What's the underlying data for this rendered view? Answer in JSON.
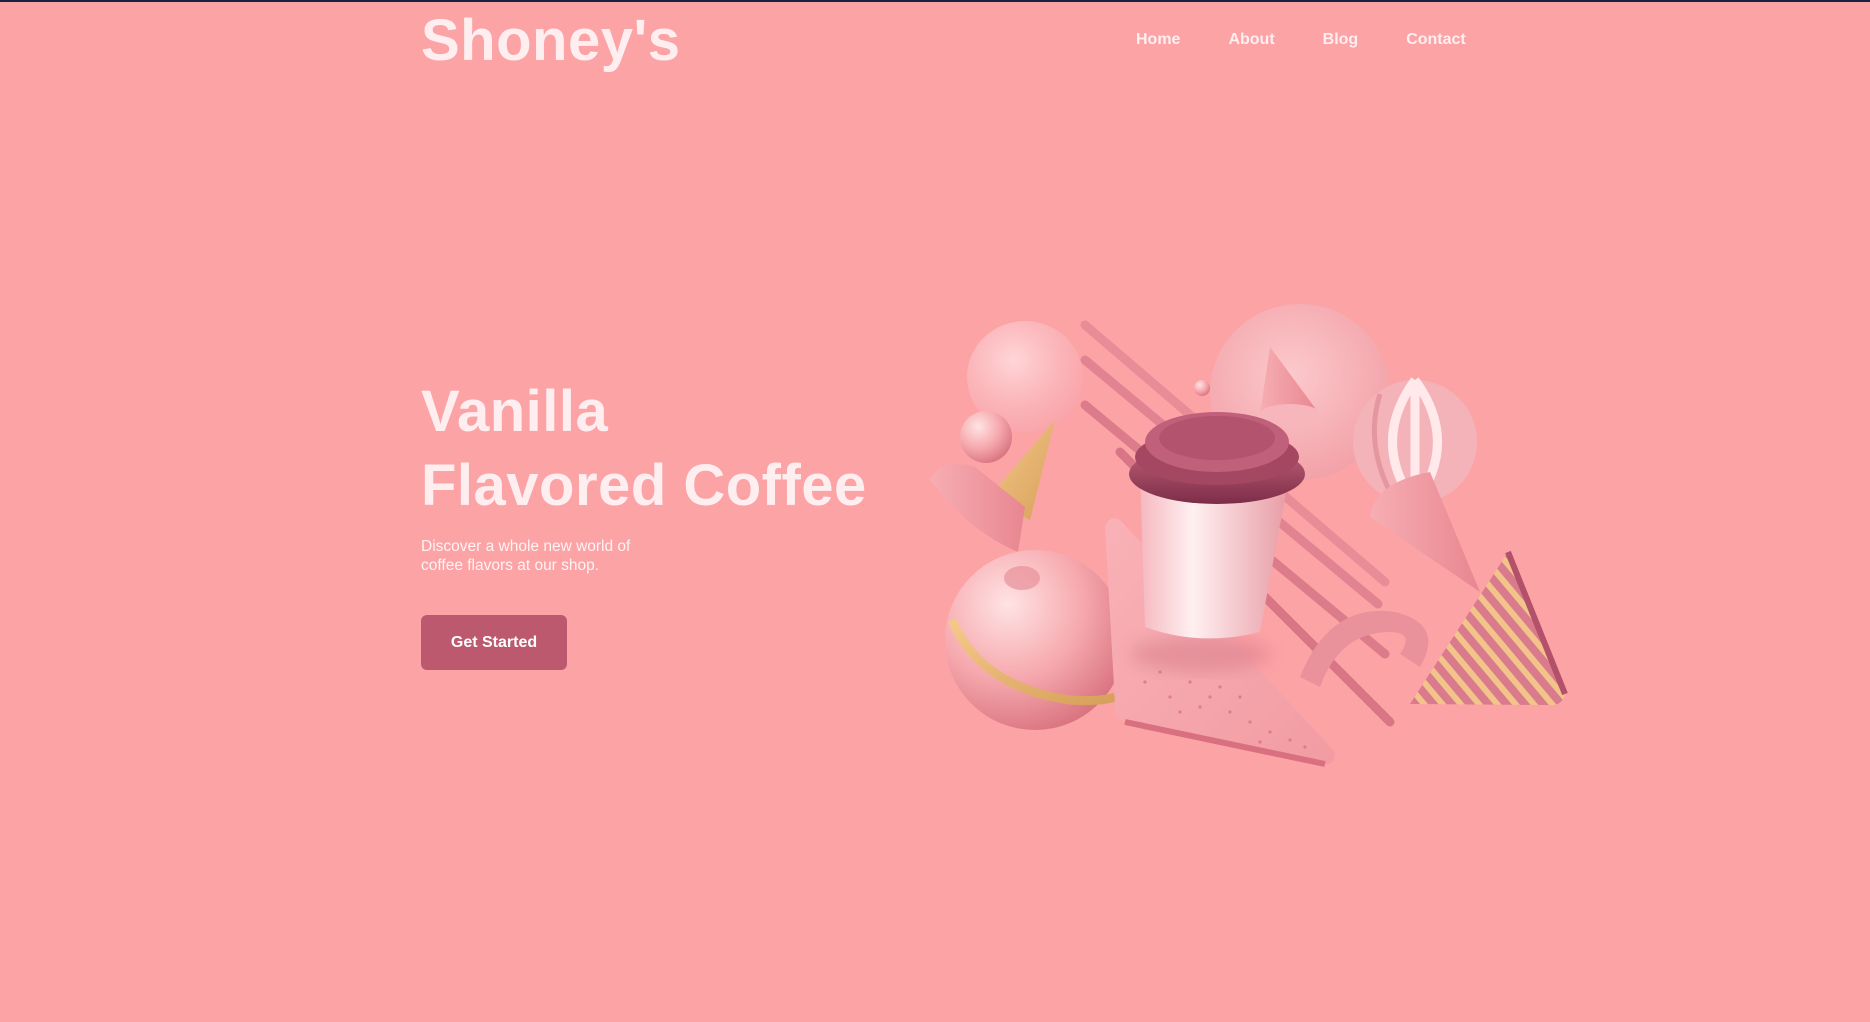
{
  "header": {
    "logo": "Shoney's",
    "nav": [
      {
        "label": "Home"
      },
      {
        "label": "About"
      },
      {
        "label": "Blog"
      },
      {
        "label": "Contact"
      }
    ]
  },
  "hero": {
    "title_line1": "Vanilla",
    "title_line2": "Flavored Coffee",
    "subtitle": "Discover a whole new world of coffee flavors at our shop.",
    "cta_label": "Get Started"
  },
  "theme": {
    "background": "#fca3a6",
    "text": "#ffeef0",
    "button": "#bd596e",
    "window_frame": "#1b2140"
  },
  "illustration": {
    "icon": "coffee-cup-3d-shapes-illustration"
  }
}
